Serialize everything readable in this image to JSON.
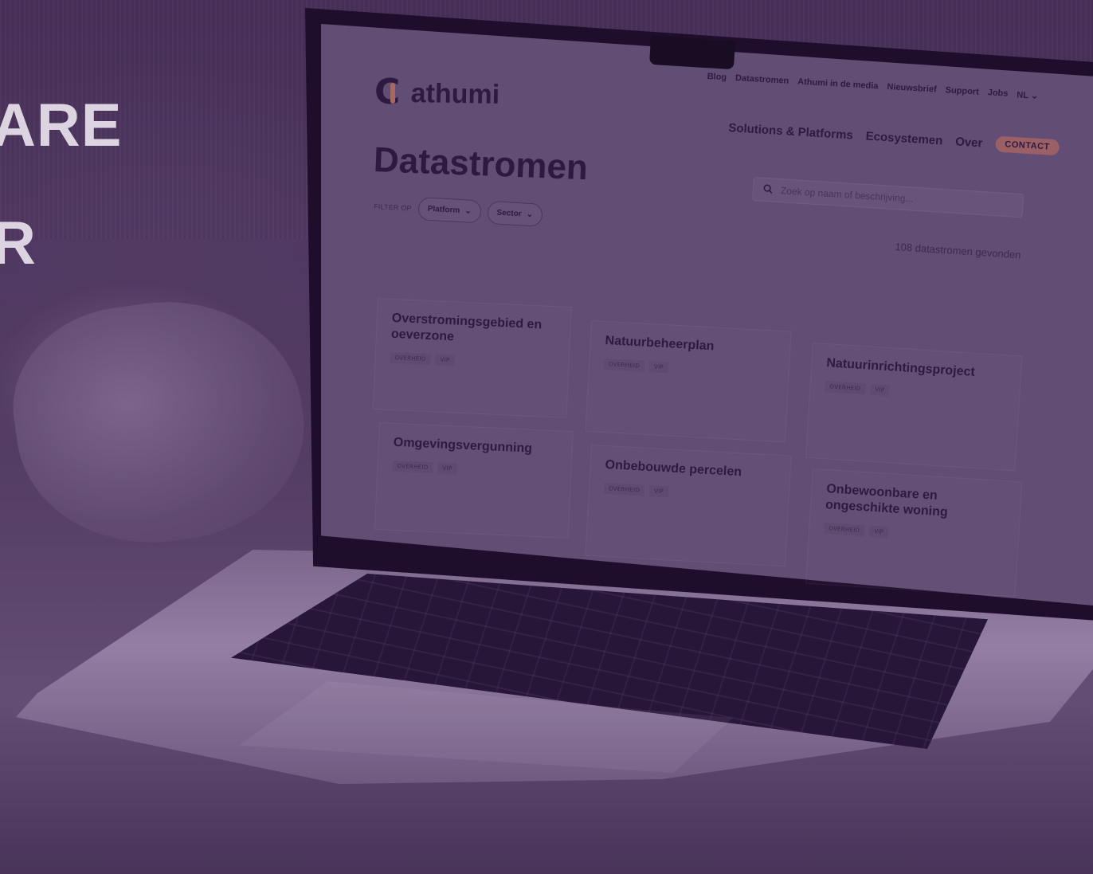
{
  "headline": {
    "line1": "ARE",
    "line2": "R"
  },
  "site": {
    "logo_text": "athumi",
    "utility_nav": [
      "Blog",
      "Datastromen",
      "Athumi in de media",
      "Nieuwsbrief",
      "Support",
      "Jobs",
      "NL"
    ],
    "main_nav": [
      "Solutions & Platforms",
      "Ecosystemen",
      "Over"
    ],
    "contact_label": "CONTACT",
    "page_title": "Datastromen",
    "filter_label": "FILTER OP",
    "filters": [
      "Platform",
      "Sector"
    ],
    "search_placeholder": "Zoek op naam of beschrijving...",
    "results_count": "108 datastromen gevonden"
  },
  "cards": [
    {
      "title": "Overstromingsgebied en oeverzone",
      "tags": [
        "OVERHEID",
        "VIP"
      ]
    },
    {
      "title": "Natuurbeheerplan",
      "tags": [
        "OVERHEID",
        "VIP"
      ]
    },
    {
      "title": "Natuurinrichtingsproject",
      "tags": [
        "OVERHEID",
        "VIP"
      ]
    },
    {
      "title": "Omgevingsvergunning",
      "tags": [
        "OVERHEID",
        "VIP"
      ]
    },
    {
      "title": "Onbebouwde percelen",
      "tags": [
        "OVERHEID",
        "VIP"
      ]
    },
    {
      "title": "Onbewoonbare en ongeschikte woning",
      "tags": [
        "OVERHEID",
        "VIP"
      ]
    }
  ],
  "icons": {
    "search": "search-icon",
    "chevron": "chevron-down-icon"
  },
  "colors": {
    "overlay": "#3c145a",
    "accent": "#c07a62",
    "text": "#2a1d3a"
  }
}
